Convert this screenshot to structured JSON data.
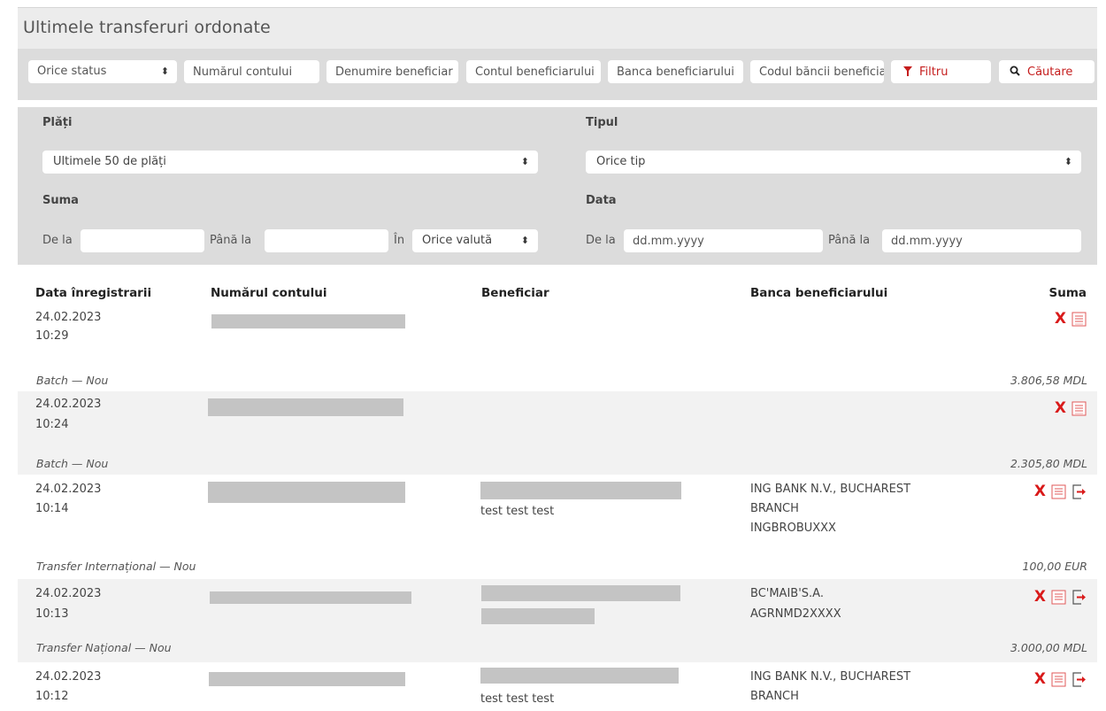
{
  "page": {
    "title": "Ultimele transferuri ordonate"
  },
  "searchbar": {
    "status_value": "Orice status",
    "account_placeholder": "Numărul contului",
    "beneficiary_name_placeholder": "Denumire beneficiar",
    "beneficiary_account_placeholder": "Contul beneficiarului",
    "beneficiary_bank_placeholder": "Banca beneficiarului",
    "bank_code_placeholder": "Codul băncii beneficiarului",
    "filter_label": "Filtru",
    "search_label": "Căutare"
  },
  "filters": {
    "payments_label": "Plăți",
    "payments_value": "Ultimele 50 de plăți",
    "type_label": "Tipul",
    "type_value": "Orice tip",
    "sum_label": "Suma",
    "sum_from_label": "De la",
    "sum_to_label": "Până la",
    "currency_in_label": "În",
    "currency_value": "Orice valută",
    "date_label": "Data",
    "date_from_label": "De la",
    "date_from_placeholder": "dd.mm.yyyy",
    "date_to_label": "Până la",
    "date_to_placeholder": "dd.mm.yyyy"
  },
  "table": {
    "headers": {
      "date": "Data înregistrarii",
      "account": "Numărul contului",
      "beneficiary": "Beneficiar",
      "bank": "Banca beneficiarului",
      "sum": "Suma"
    },
    "rows": [
      {
        "date": "24.02.2023",
        "time": "10:29",
        "beneficiary": "",
        "bank_line1": "",
        "bank_line2": "",
        "bank_line3": "",
        "type": "Batch — Nou",
        "amount": "3.806,58 MDL"
      },
      {
        "date": "24.02.2023",
        "time": "10:24",
        "beneficiary": "",
        "bank_line1": "",
        "bank_line2": "",
        "bank_line3": "",
        "type": "Batch — Nou",
        "amount": "2.305,80 MDL"
      },
      {
        "date": "24.02.2023",
        "time": "10:14",
        "beneficiary": "test test test",
        "bank_line1": "ING BANK N.V., BUCHAREST",
        "bank_line2": "BRANCH",
        "bank_line3": "INGBROBUXXX",
        "type": "Transfer Internațional — Nou",
        "amount": "100,00 EUR"
      },
      {
        "date": "24.02.2023",
        "time": "10:13",
        "beneficiary": "",
        "bank_line1": "BC'MAIB'S.A.",
        "bank_line2": "AGRNMD2XXXX",
        "bank_line3": "",
        "type": "Transfer Național — Nou",
        "amount": "3.000,00 MDL"
      },
      {
        "date": "24.02.2023",
        "time": "10:12",
        "beneficiary": "test test test",
        "bank_line1": "ING BANK N.V., BUCHAREST",
        "bank_line2": "BRANCH",
        "bank_line3": "",
        "type": "",
        "amount": ""
      }
    ]
  },
  "colors": {
    "accent_red": "#c51d1d",
    "panel_gray": "#dcdcdc",
    "header_gray": "#ececec",
    "row_alt": "#f2f2f2",
    "redaction": "#c4c4c4"
  },
  "icons": {
    "filter": "filter-icon",
    "search": "search-icon",
    "delete": "delete-x-icon",
    "details": "document-list-icon",
    "export": "export-icon",
    "select_arrows": "updown-arrows-icon"
  }
}
